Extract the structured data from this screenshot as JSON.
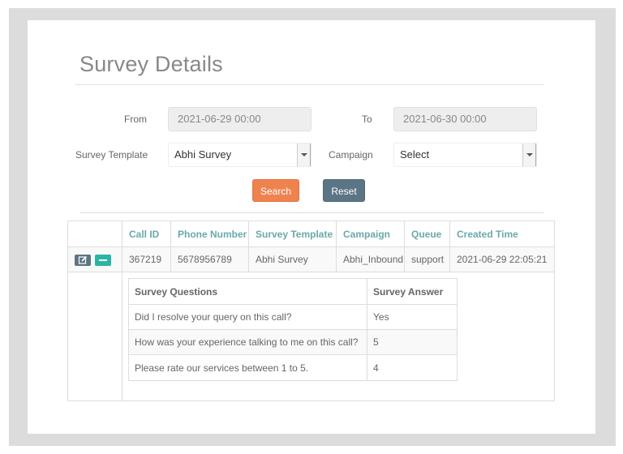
{
  "page": {
    "title": "Survey Details"
  },
  "filters": {
    "from_label": "From",
    "from_value": "2021-06-29 00:00",
    "to_label": "To",
    "to_value": "2021-06-30 00:00",
    "template_label": "Survey Template",
    "template_value": "Abhi Survey",
    "campaign_label": "Campaign",
    "campaign_value": "Select"
  },
  "buttons": {
    "search": "Search",
    "reset": "Reset"
  },
  "table": {
    "headers": [
      "Call ID",
      "Phone Number",
      "Survey Template",
      "Campaign",
      "Queue",
      "Created Time"
    ],
    "row": [
      "367219",
      "5678956789",
      "Abhi Survey",
      "Abhi_Inbound",
      "support",
      "2021-06-29 22:05:21"
    ]
  },
  "survey": {
    "headers": [
      "Survey Questions",
      "Survey Answer"
    ],
    "rows": [
      {
        "question": "Did I resolve your query on this call?",
        "answer": "Yes"
      },
      {
        "question": "How was your experience talking to me on this call?",
        "answer": "5"
      },
      {
        "question": "Please rate our services between 1 to 5.",
        "answer": "4"
      }
    ]
  },
  "colors": {
    "search": "#ef8350",
    "reset": "#5b7584",
    "header_text": "#6aa9a9",
    "collapse": "#2bb5a5"
  },
  "icons": {
    "edit": "edit-icon",
    "collapse": "minus-icon"
  }
}
